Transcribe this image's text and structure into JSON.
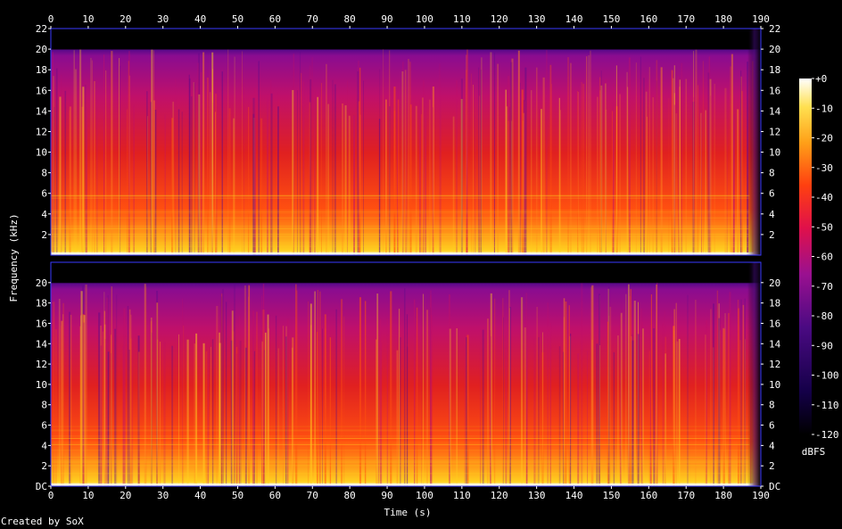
{
  "chart_data": {
    "type": "heatmap",
    "title": "",
    "xlabel": "Time (s)",
    "ylabel": "Frequency (kHz)",
    "xlim": [
      0,
      190
    ],
    "ylim": [
      0,
      22
    ],
    "x_ticks": [
      "0",
      "10",
      "20",
      "30",
      "40",
      "50",
      "60",
      "70",
      "80",
      "90",
      "100",
      "110",
      "120",
      "130",
      "140",
      "150",
      "160",
      "170",
      "180",
      "190"
    ],
    "y_ticks_channel1": [
      "2",
      "4",
      "6",
      "8",
      "10",
      "12",
      "14",
      "16",
      "18",
      "20",
      "22"
    ],
    "y_ticks_channel2": [
      "DC",
      "2",
      "4",
      "6",
      "8",
      "10",
      "12",
      "14",
      "16",
      "18",
      "20"
    ],
    "channels": 2,
    "audio_end_s": 190,
    "content_cutoff_khz": 20,
    "colorbar": {
      "label": "dBFS",
      "ticks": [
        "+0",
        "-10",
        "-20",
        "-30",
        "-40",
        "-50",
        "-60",
        "-70",
        "-80",
        "-90",
        "-100",
        "-110",
        "-120"
      ],
      "range": [
        -120,
        0
      ]
    },
    "colors": {
      "c_loud": "#ffffe8",
      "c_high": "#ffd020",
      "c_mid": "#ff5010",
      "c_low": "#c0106a",
      "c_quiet": "#5a0a8a",
      "c_floor": "#140048",
      "background": "#000000"
    }
  },
  "credit": "Created by SoX"
}
